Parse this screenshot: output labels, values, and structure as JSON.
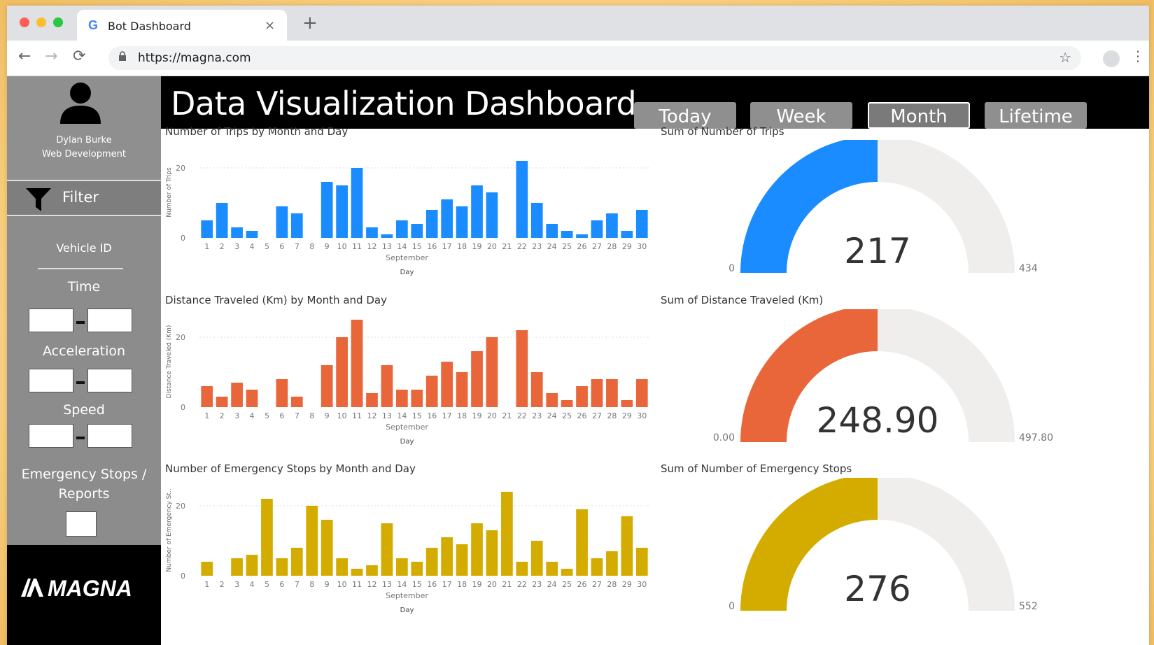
{
  "browser": {
    "tab_title": "Bot Dashboard",
    "tab_icon": "G",
    "tab_close": "×",
    "new_tab": "+",
    "url": "https://magna.com",
    "back": "←",
    "forward": "→",
    "reload": "⟳",
    "lock": "🔒",
    "star": "☆",
    "menu": "⋮"
  },
  "sidebar": {
    "user_name": "Dylan Burke",
    "user_role": "Web Development",
    "filter_label": "Filter",
    "vehicle_id_label": "Vehicle ID",
    "time_label": "Time",
    "acceleration_label": "Acceleration",
    "speed_label": "Speed",
    "emergency_label_1": "Emergency Stops /",
    "emergency_label_2": "Reports",
    "logo_text": "MAGNA"
  },
  "header": {
    "title": "Data Visualization Dashboard",
    "periods": [
      "Today",
      "Week",
      "Month",
      "Lifetime"
    ],
    "active_period": "Month"
  },
  "colors": {
    "trips": "#1a8cff",
    "distance": "#e8663a",
    "emergency": "#d4ac00",
    "gauge_track": "#efeeed"
  },
  "chart_data": [
    {
      "type": "bar",
      "title": "Number of Trips by Month and Day",
      "xlabel": "Day",
      "xsublabel": "September",
      "ylabel": "Number of Trips",
      "yticks": [
        0,
        20
      ],
      "ylim": [
        0,
        26
      ],
      "categories": [
        "1",
        "2",
        "3",
        "4",
        "5",
        "6",
        "7",
        "8",
        "9",
        "10",
        "11",
        "12",
        "13",
        "14",
        "15",
        "16",
        "17",
        "18",
        "19",
        "20",
        "21",
        "22",
        "23",
        "24",
        "25",
        "26",
        "27",
        "28",
        "29",
        "30"
      ],
      "values": [
        5,
        10,
        3,
        2,
        0,
        9,
        7,
        0,
        16,
        15,
        20,
        3,
        1,
        5,
        4,
        8,
        11,
        9,
        15,
        13,
        0,
        22,
        10,
        4,
        2,
        1,
        5,
        7,
        2,
        8
      ]
    },
    {
      "type": "bar",
      "title": "Distance Traveled (Km) by Month and Day",
      "xlabel": "Day",
      "xsublabel": "September",
      "ylabel": "Distance Traveled (Km)",
      "yticks": [
        0,
        20
      ],
      "ylim": [
        0,
        26
      ],
      "categories": [
        "1",
        "2",
        "3",
        "4",
        "5",
        "6",
        "7",
        "8",
        "9",
        "10",
        "11",
        "12",
        "13",
        "14",
        "15",
        "16",
        "17",
        "18",
        "19",
        "20",
        "21",
        "22",
        "23",
        "24",
        "25",
        "26",
        "27",
        "28",
        "29",
        "30"
      ],
      "values": [
        6,
        3,
        7,
        5,
        0,
        8,
        3,
        0,
        12,
        20,
        25,
        4,
        12,
        5,
        5,
        9,
        13,
        10,
        16,
        20,
        0,
        22,
        10,
        4,
        2,
        6,
        8,
        8,
        2,
        8
      ]
    },
    {
      "type": "bar",
      "title": "Number of Emergency Stops by Month and Day",
      "xlabel": "Day",
      "xsublabel": "September",
      "ylabel": "Number of Emergency St..",
      "yticks": [
        0,
        20
      ],
      "ylim": [
        0,
        26
      ],
      "categories": [
        "1",
        "2",
        "3",
        "4",
        "5",
        "6",
        "7",
        "8",
        "9",
        "10",
        "11",
        "12",
        "13",
        "14",
        "15",
        "16",
        "17",
        "18",
        "19",
        "20",
        "21",
        "22",
        "23",
        "24",
        "25",
        "26",
        "27",
        "28",
        "29",
        "30"
      ],
      "values": [
        4,
        0,
        5,
        6,
        22,
        5,
        8,
        20,
        16,
        5,
        2,
        3,
        15,
        5,
        4,
        8,
        11,
        9,
        15,
        13,
        24,
        4,
        10,
        4,
        2,
        19,
        5,
        7,
        17,
        8
      ]
    }
  ],
  "gauges": [
    {
      "title": "Sum of Number of Trips",
      "value": 217,
      "display": "217",
      "min_label": "0",
      "max_label": "434",
      "max": 434
    },
    {
      "title": "Sum of Distance Traveled (Km)",
      "value": 248.9,
      "display": "248.90",
      "min_label": "0.00",
      "max_label": "497.80",
      "max": 497.8
    },
    {
      "title": "Sum of Number of Emergency Stops",
      "value": 276,
      "display": "276",
      "min_label": "0",
      "max_label": "552",
      "max": 552
    }
  ]
}
